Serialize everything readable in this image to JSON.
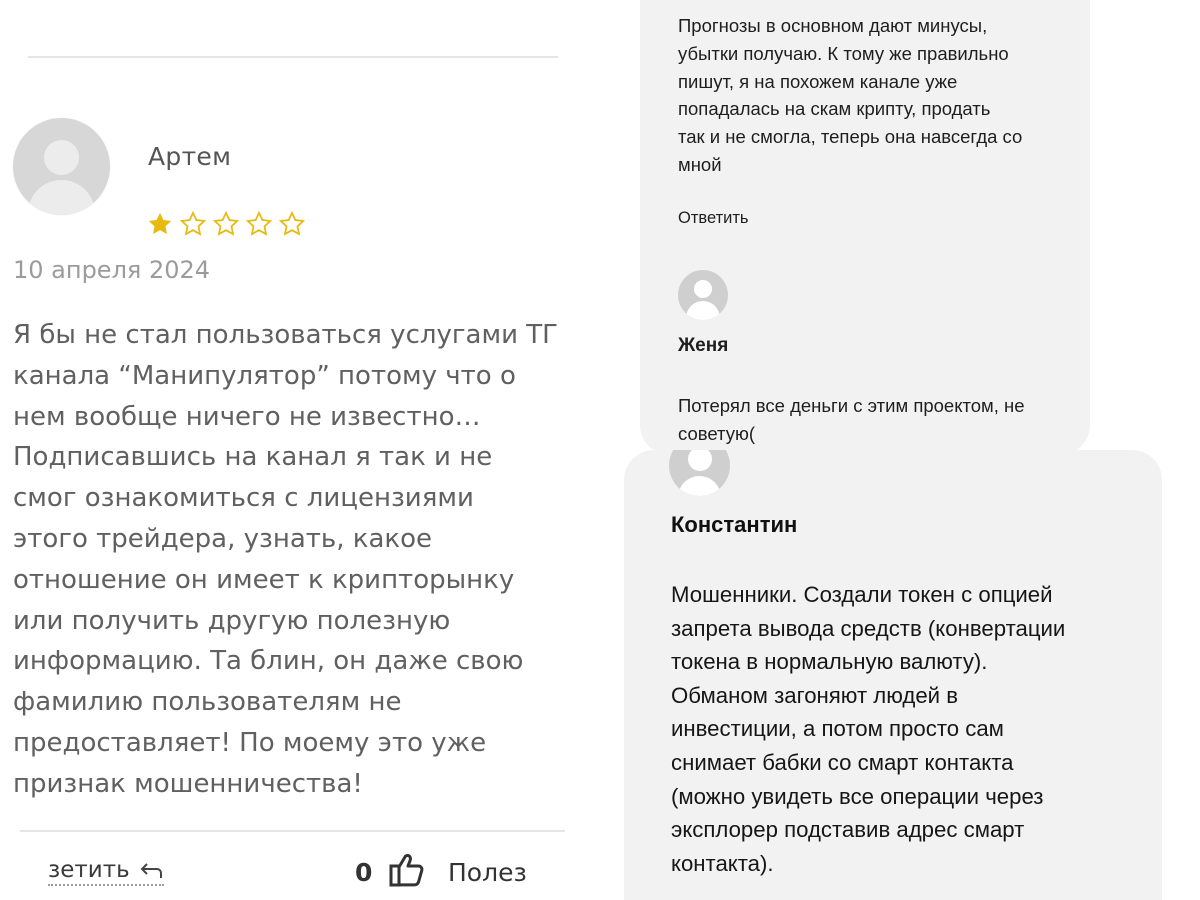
{
  "review": {
    "author": "Артем",
    "rating": 1,
    "rating_max": 5,
    "date": "10 апреля 2024",
    "text": "Я бы не стал пользоваться услугами ТГ\nканала “Манипулятор” потому что о\nнем вообще ничего не известно…\nПодписавшись на канал я так и не\nсмог ознакомиться с лицензиями\nэтого трейдера, узнать, какое\nотношение он имеет к крипторынку\nили получить другую полезную\nинформацию. Та блин, он даже свою\nфамилию пользователям не\nпредоставляет! По моему это уже\nпризнак мошенничества!",
    "reply_label": "зетить",
    "likes": "0",
    "useful_label": "Полез"
  },
  "comments": [
    {
      "author": "",
      "text": "Прогнозы в основном дают минусы,\nубытки получаю. К тому же правильно\nпишут, я на похожем канале уже\nпопадалась на скам крипту, продать\nтак и не смогла, теперь она навсегда со\nмной",
      "reply_label": "Ответить"
    },
    {
      "author": "Женя",
      "text": "Потерял все деньги с этим проектом, не\nсоветую("
    },
    {
      "author": "Константин",
      "text": "Мошенники. Создали токен с опцией\nзапрета вывода средств (конвертации\nтокена в нормальную валюту).\nОбманом загоняют людей в\nинвестиции, а потом просто сам\nснимает бабки со смарт контакта\n(можно увидеть все операции через\nэксплорер подставив адрес смарт\nконтакта)."
    }
  ],
  "colors": {
    "star_filled": "#e8b90f",
    "star_empty": "#e8b90f",
    "card_background": "#f2f2f2",
    "muted_text": "#606060"
  },
  "icons": {
    "reply": "reply-arrow-icon",
    "like": "thumbs-up-icon",
    "avatar": "user-avatar-icon",
    "star": "star-icon"
  }
}
